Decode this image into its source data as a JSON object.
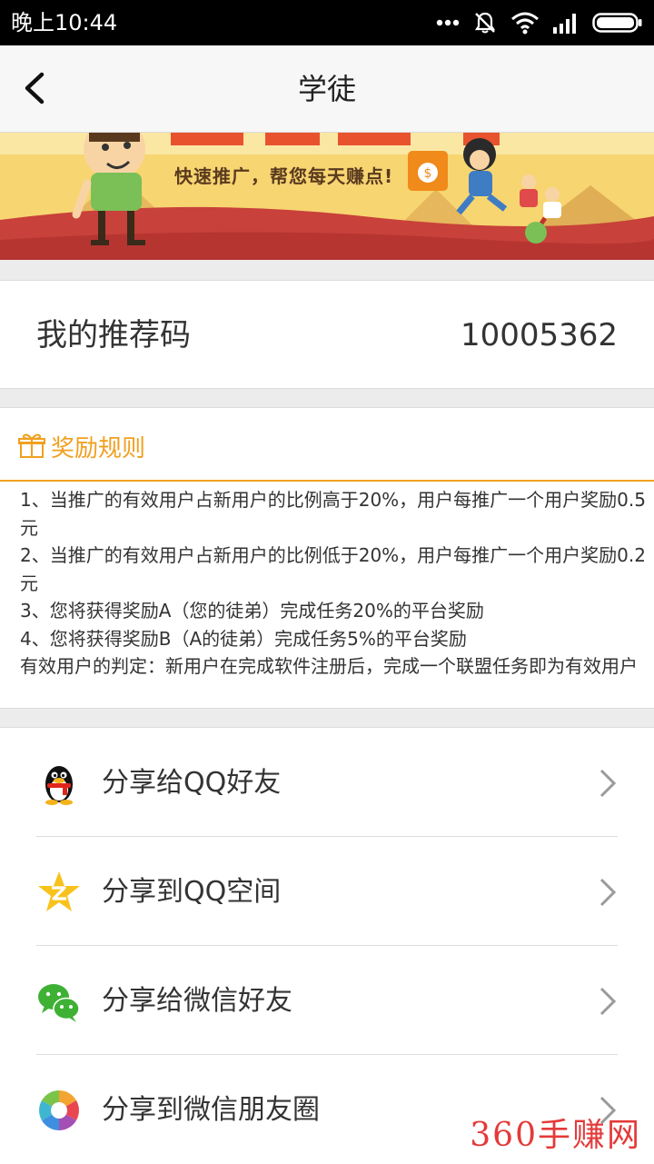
{
  "status_bar": {
    "time": "晚上10:44"
  },
  "header": {
    "title": "学徒"
  },
  "banner": {
    "tagline": "快速推广，帮您每天赚点!"
  },
  "referral": {
    "label": "我的推荐码",
    "code": "10005362"
  },
  "rules": {
    "title": "奖励规则",
    "items": [
      "1、当推广的有效用户占新用户的比例高于20%，用户每推广一个用户奖励0.5元",
      "2、当推广的有效用户占新用户的比例低于20%，用户每推广一个用户奖励0.2元",
      "3、您将获得奖励A（您的徒弟）完成任务20%的平台奖励",
      "4、您将获得奖励B（A的徒弟）完成任务5%的平台奖励",
      "有效用户的判定：新用户在完成软件注册后，完成一个联盟任务即为有效用户"
    ]
  },
  "share": {
    "items": [
      {
        "label": "分享给QQ好友",
        "icon": "qq-penguin-icon"
      },
      {
        "label": "分享到QQ空间",
        "icon": "qzone-star-icon"
      },
      {
        "label": "分享给微信好友",
        "icon": "wechat-icon"
      },
      {
        "label": "分享到微信朋友圈",
        "icon": "moments-icon"
      }
    ]
  },
  "watermark": "360手赚网",
  "colors": {
    "accent": "#f0a020",
    "watermark": "#e43a3a",
    "banner_yellow": "#f7d571",
    "banner_red": "#c8413a"
  }
}
